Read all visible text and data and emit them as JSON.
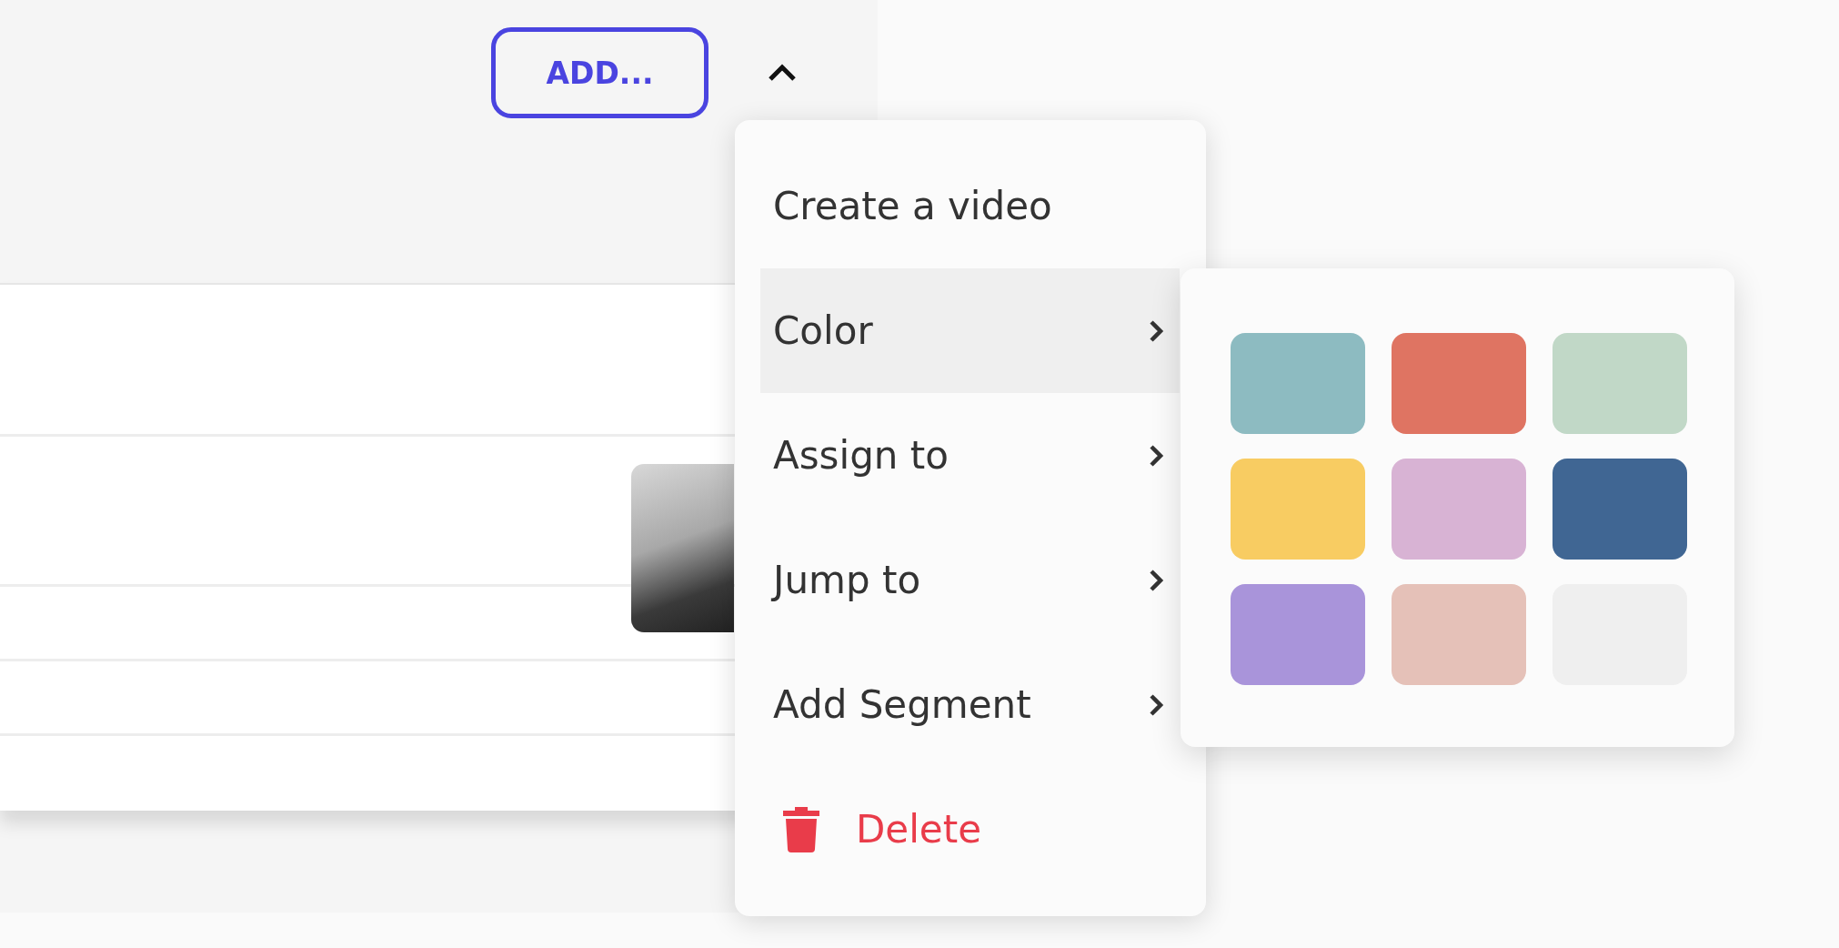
{
  "toolbar": {
    "add_button": "ADD...",
    "collapse_toggle": {
      "expanded": true
    }
  },
  "list": {
    "rows": [
      {
        "kind": "tall"
      },
      {
        "kind": "media"
      },
      {
        "kind": "short"
      },
      {
        "kind": "short"
      },
      {
        "kind": "short"
      }
    ]
  },
  "menu": {
    "items": [
      {
        "kind": "action",
        "label": "Create a video",
        "selected": false
      },
      {
        "kind": "submenu",
        "label": "Color",
        "selected": true
      },
      {
        "kind": "submenu",
        "label": "Assign to",
        "selected": false
      },
      {
        "kind": "submenu",
        "label": "Jump to",
        "selected": false
      },
      {
        "kind": "submenu",
        "label": "Add Segment",
        "selected": false
      },
      {
        "kind": "danger",
        "label": "Delete",
        "selected": false
      }
    ]
  },
  "color_submenu": {
    "swatches": [
      {
        "color": "#8dbbc1"
      },
      {
        "color": "#df7462"
      },
      {
        "color": "#c1d8c7"
      },
      {
        "color": "#f8cc62"
      },
      {
        "color": "#d8b3d4"
      },
      {
        "color": "#406693"
      },
      {
        "color": "#a994da"
      },
      {
        "color": "#e5c1b8"
      },
      {
        "color": "#efefef"
      }
    ]
  }
}
